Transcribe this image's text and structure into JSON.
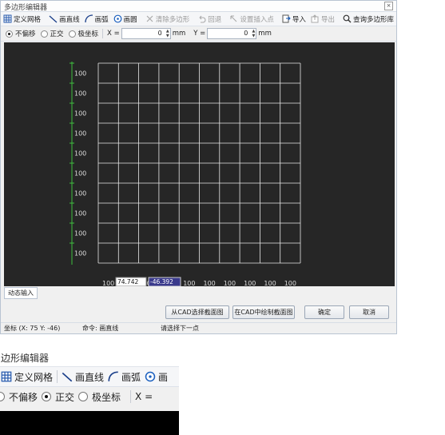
{
  "window": {
    "title": "多边形编辑器",
    "close_glyph": "×"
  },
  "toolbar": {
    "define_grid": "定义网格",
    "draw_line": "画直线",
    "draw_arc": "画弧",
    "draw_circle": "画圆",
    "clear_polygon": "清除多边形",
    "undo": "回退",
    "set_insert_point": "设置插入点",
    "import": "导入",
    "export": "导出",
    "query_library": "查询多边形库"
  },
  "options": {
    "no_offset": "不偏移",
    "orthogonal": "正交",
    "polar": "极坐标",
    "x_label": "X =",
    "x_value": "0",
    "y_label": "Y =",
    "y_value": "0",
    "unit": "mm"
  },
  "grid": {
    "row_labels": [
      "100",
      "100",
      "100",
      "100",
      "100",
      "100",
      "100",
      "100",
      "100",
      "100"
    ],
    "col_labels": [
      "100",
      "100",
      "100",
      "100",
      "100",
      "100",
      "100",
      "100",
      "100",
      "100"
    ],
    "input_a": "74.742",
    "input_b": "-46.392"
  },
  "dynamic_input": "动态输入",
  "buttons": {
    "select_from_cad": "从CAD选择截面图",
    "draw_in_cad": "在CAD中绘制截面图",
    "ok": "确定",
    "cancel": "取消"
  },
  "status": {
    "coord": "坐标 (X: 75 Y: -46)",
    "command": "命令: 画直线",
    "prompt": "请选择下一点"
  },
  "zoom": {
    "title": "边形编辑器",
    "define_grid": "定义网格",
    "draw_line": "画直线",
    "draw_arc": "画弧",
    "draw_circle_partial": "画",
    "no_offset": "不偏移",
    "orthogonal": "正交",
    "polar": "极坐标",
    "x_label": "X ="
  },
  "colors": {
    "grid_line": "#e8e8e8",
    "axis": "#3fbf3f",
    "canvas": "#262626",
    "input_highlight": "#3a3a8c"
  }
}
